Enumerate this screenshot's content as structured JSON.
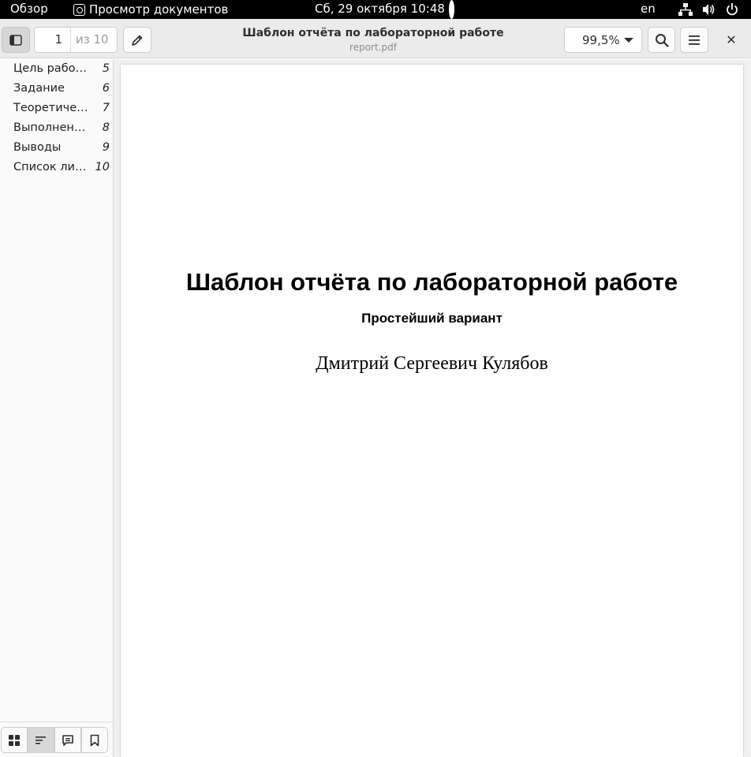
{
  "system_bar": {
    "overview": "Обзор",
    "app_name": "Просмотр документов",
    "clock": "Сб, 29 октября  10:48",
    "language": "en"
  },
  "header": {
    "page_current": "1",
    "page_total": "из 10",
    "title": "Шаблон отчёта по лабораторной работе",
    "filename": "report.pdf",
    "zoom": "99,5%"
  },
  "outline": [
    {
      "label": "Цель работы",
      "page": "5"
    },
    {
      "label": "Задание",
      "page": "6"
    },
    {
      "label": "Теоретическое введение",
      "page": "7"
    },
    {
      "label": "Выполнение лабораторной работы",
      "page": "8"
    },
    {
      "label": "Выводы",
      "page": "9"
    },
    {
      "label": "Список литературы",
      "page": "10"
    }
  ],
  "document": {
    "title": "Шаблон отчёта по лабораторной работе",
    "subtitle": "Простейший вариант",
    "author": "Дмитрий Сергеевич Кулябов"
  },
  "icons": {
    "close": "✕"
  }
}
